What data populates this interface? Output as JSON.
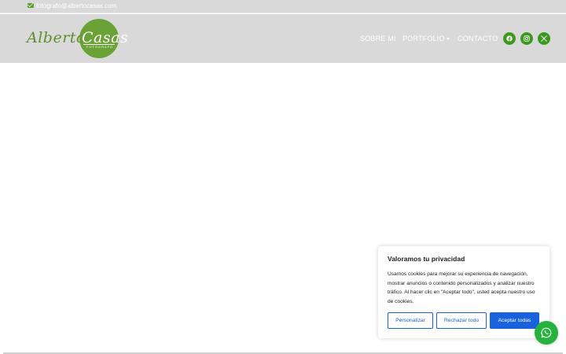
{
  "topbar": {
    "email": "fotografo@albertocasas.com",
    "email_icon": "mail-icon"
  },
  "logo": {
    "script_first": "Alberto",
    "script_second": "Casas",
    "subtitle": "FOTOGRAFO",
    "accent": "#6aa235"
  },
  "nav": {
    "items": [
      {
        "label": "SOBRE MI"
      },
      {
        "label": "PORTFOLIO",
        "has_dropdown": true
      },
      {
        "label": "CONTACTO"
      }
    ]
  },
  "social": [
    {
      "icon": "facebook-icon"
    },
    {
      "icon": "instagram-icon"
    },
    {
      "icon": "x-twitter-icon"
    }
  ],
  "cookie_banner": {
    "title": "Valoramos tu privacidad",
    "body": "Usamos cookies para mejorar su experiencia de navegación, mostrar anuncios o contenido personalizados y analizar nuestro tráfico. Al hacer clic en \"Aceptar todo\", usted acepta nuestro uso de cookies.",
    "buttons": {
      "customize": "Personalizar",
      "reject": "Rechazar todo",
      "accept": "Aceptar todas"
    },
    "accent": "#1863dc"
  },
  "whatsapp": {
    "icon": "whatsapp-icon",
    "color": "#25b33e"
  },
  "colors": {
    "header_bg": "#d9d9d9",
    "social_bg": "#3a9a1e"
  }
}
